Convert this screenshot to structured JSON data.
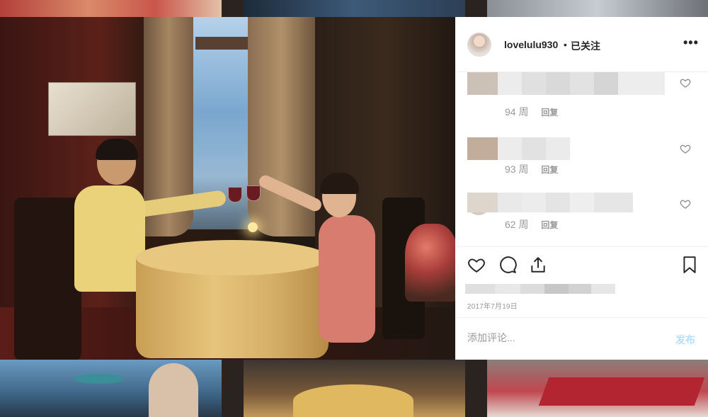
{
  "header": {
    "username": "lovelulu930",
    "separator": "•",
    "follow_status": "已关注",
    "more_icon": "more-icon",
    "more_glyph": "•••"
  },
  "comments": [
    {
      "time": "94 周",
      "reply_label": "回复",
      "text_hidden": true
    },
    {
      "time": "93 周",
      "reply_label": "回复",
      "text_hidden": true
    },
    {
      "time": "62 周",
      "reply_label": "回复",
      "text_hidden": true
    }
  ],
  "actions": {
    "like_icon": "heart-icon",
    "comment_icon": "comment-icon",
    "share_icon": "share-icon",
    "save_icon": "bookmark-icon",
    "date": "2017年7月19日"
  },
  "comment_box": {
    "placeholder": "添加评论...",
    "post_label": "发布"
  },
  "colors": {
    "post_button": "#b2dffc",
    "muted_text": "#999999",
    "primary_text": "#262626"
  }
}
